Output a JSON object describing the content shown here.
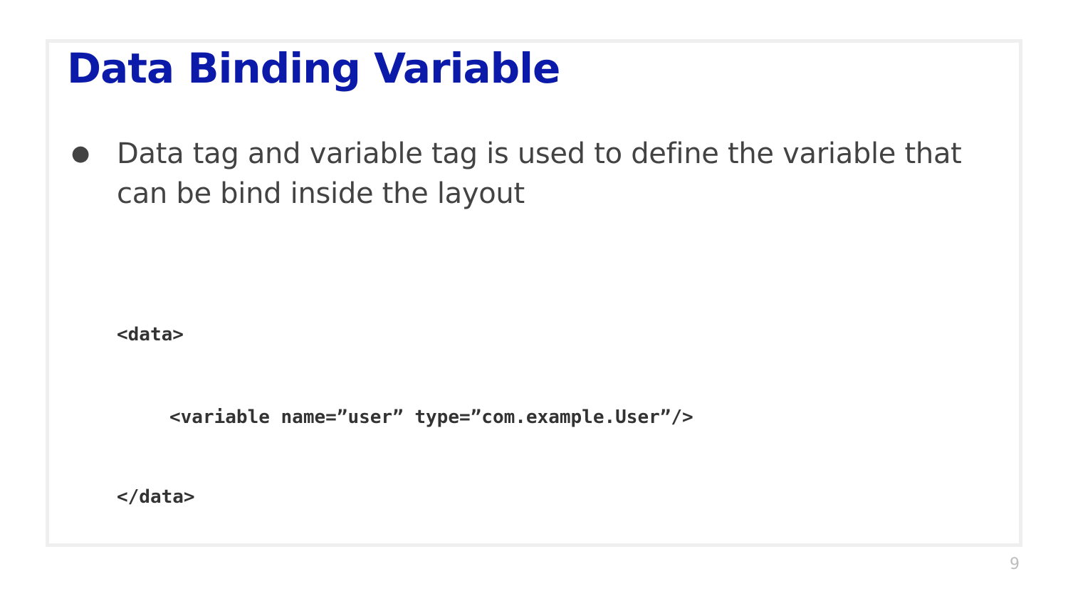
{
  "slide": {
    "title": "Data Binding Variable",
    "bullets": [
      {
        "marker": "●",
        "text": "Data tag and variable tag is used to define the variable that can be bind inside the layout"
      }
    ],
    "code_lines": [
      "<data>",
      "<variable name=”user” type=”com.example.User”/>",
      "</data>"
    ],
    "page_number": "9"
  },
  "colors": {
    "title": "#0b1aa8",
    "body_text": "#434343",
    "code_text": "#333333",
    "frame_border": "#efefef",
    "page_number": "#bdbdbd"
  }
}
